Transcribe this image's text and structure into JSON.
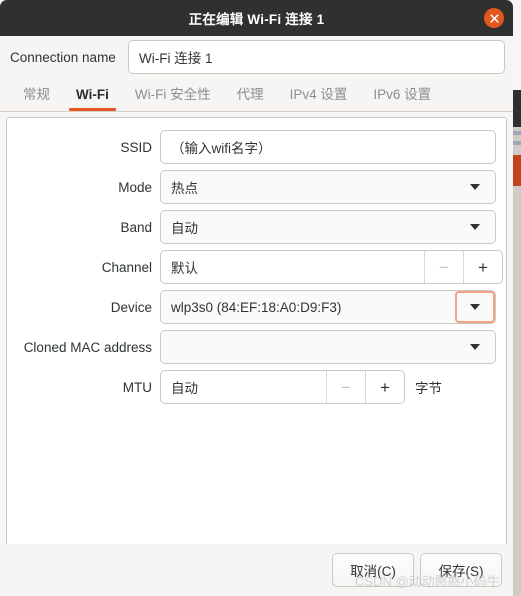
{
  "window": {
    "title": "正在编辑 Wi-Fi 连接 1",
    "close_icon": "close-icon",
    "accent_color": "#e95420",
    "close_button_color": "#e2571e",
    "titlebar_color": "#303030"
  },
  "connection": {
    "label": "Connection name",
    "value": "Wi-Fi 连接 1",
    "placeholder": ""
  },
  "tabs": [
    {
      "label": "常规",
      "active": false
    },
    {
      "label": "Wi-Fi",
      "active": true
    },
    {
      "label": "Wi-Fi 安全性",
      "active": false
    },
    {
      "label": "代理",
      "active": false
    },
    {
      "label": "IPv4 设置",
      "active": false
    },
    {
      "label": "IPv6 设置",
      "active": false
    }
  ],
  "form": {
    "ssid": {
      "label": "SSID",
      "value": "（输入wifi名字）"
    },
    "mode": {
      "label": "Mode",
      "value": "热点",
      "arrow_icon": "chevron-down-icon"
    },
    "band": {
      "label": "Band",
      "value": "自动",
      "arrow_icon": "chevron-down-icon"
    },
    "channel": {
      "label": "Channel",
      "value": "默认",
      "decrement_label": "−",
      "increment_label": "+"
    },
    "device": {
      "label": "Device",
      "value": "wlp3s0 (84:EF:18:A0:D9:F3)",
      "arrow_icon": "chevron-down-icon",
      "focused": true,
      "focus_color": "#f3a183"
    },
    "cloned_mac": {
      "label": "Cloned MAC address",
      "value": "",
      "arrow_icon": "chevron-down-icon"
    },
    "mtu": {
      "label": "MTU",
      "value": "自动",
      "decrement_label": "−",
      "increment_label": "+",
      "unit": "字节"
    }
  },
  "actions": {
    "cancel": "取消(C)",
    "save": "保存(S)"
  },
  "watermark": "CSDN @动动憨憨小码牛"
}
